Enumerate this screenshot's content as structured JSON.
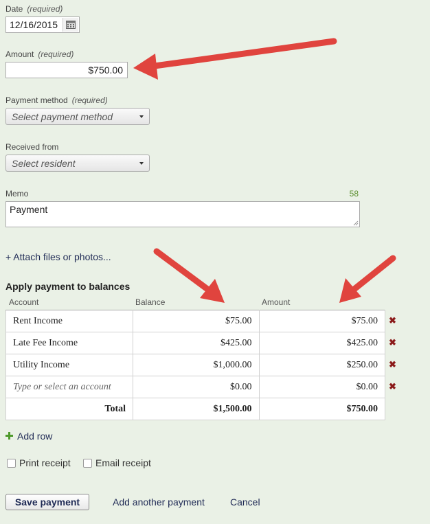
{
  "date": {
    "label": "Date",
    "required": "(required)",
    "value": "12/16/2015"
  },
  "amount": {
    "label": "Amount",
    "required": "(required)",
    "value": "$750.00"
  },
  "payment_method": {
    "label": "Payment method",
    "required": "(required)",
    "placeholder": "Select payment method"
  },
  "received_from": {
    "label": "Received from",
    "placeholder": "Select resident"
  },
  "memo": {
    "label": "Memo",
    "counter": "58",
    "value": "Payment"
  },
  "attach_link": "+ Attach files or photos...",
  "apply": {
    "title": "Apply payment to balances",
    "headers": {
      "account": "Account",
      "balance": "Balance",
      "amount": "Amount"
    },
    "rows": [
      {
        "account": "Rent Income",
        "balance": "$75.00",
        "amount": "$75.00"
      },
      {
        "account": "Late Fee Income",
        "balance": "$425.00",
        "amount": "$425.00"
      },
      {
        "account": "Utility Income",
        "balance": "$1,000.00",
        "amount": "$250.00"
      },
      {
        "account": "Type or select an account",
        "balance": "$0.00",
        "amount": "$0.00"
      }
    ],
    "total": {
      "label": "Total",
      "balance": "$1,500.00",
      "amount": "$750.00"
    },
    "delete_icon": "✖"
  },
  "add_row": "Add row",
  "print_receipt": "Print receipt",
  "email_receipt": "Email receipt",
  "buttons": {
    "save": "Save payment",
    "add_another": "Add another payment",
    "cancel": "Cancel"
  },
  "colors": {
    "arrow": "#e0443e",
    "background": "#eaf1e6",
    "link": "#1f2a55",
    "counter": "#5a8f2e"
  }
}
